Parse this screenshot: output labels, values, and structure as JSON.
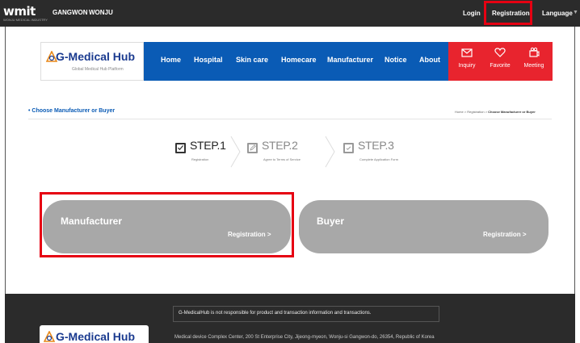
{
  "topbar": {
    "brand": "wmit",
    "brand_sub": "WONJU MEDICAL INDUSTRY",
    "region_1": "GANGWON",
    "region_2": "WONJU",
    "login": "Login",
    "registration": "Registration",
    "language": "Language"
  },
  "nav": {
    "logo": "G-Medical Hub",
    "logo_sub": "Global Medical Hub Platform",
    "items": [
      "Home",
      "Hospital",
      "Skin care",
      "Homecare",
      "Manufacturer",
      "Notice",
      "About"
    ],
    "quick": [
      {
        "label": "Inquiry",
        "icon": "envelope-icon"
      },
      {
        "label": "Favorite",
        "icon": "heart-icon"
      },
      {
        "label": "Meeting",
        "icon": "video-icon"
      }
    ]
  },
  "page": {
    "title": "Choose Manufacturer or Buyer",
    "breadcrumb_home": "Home",
    "breadcrumb_sep": " > ",
    "breadcrumb_mid": "Registration",
    "breadcrumb_current": "Choose Manufacturer or Buyer"
  },
  "steps": [
    {
      "title": "STEP.1",
      "desc": "Registration"
    },
    {
      "title": "STEP.2",
      "desc": "Agree to Terms of Service"
    },
    {
      "title": "STEP.3",
      "desc": "Complete Application Form"
    }
  ],
  "cards": [
    {
      "title": "Manufacturer",
      "action": "Registration >"
    },
    {
      "title": "Buyer",
      "action": "Registration >"
    }
  ],
  "footer": {
    "logo": "G-Medical Hub",
    "notice": "G-MedicalHub is not responsible for product and transaction information and transactions.",
    "address": "Medical device Complex Center, 200 St Enterprise City, Jijeong-myeon, Wonju-si Gangwon-do, 26354, Republic of Korea"
  },
  "colors": {
    "nav_blue": "#0a5bb5",
    "quick_red": "#e8242e",
    "highlight": "#e60012",
    "card_gray": "#a8a8a8",
    "dark": "#2b2b2b"
  }
}
